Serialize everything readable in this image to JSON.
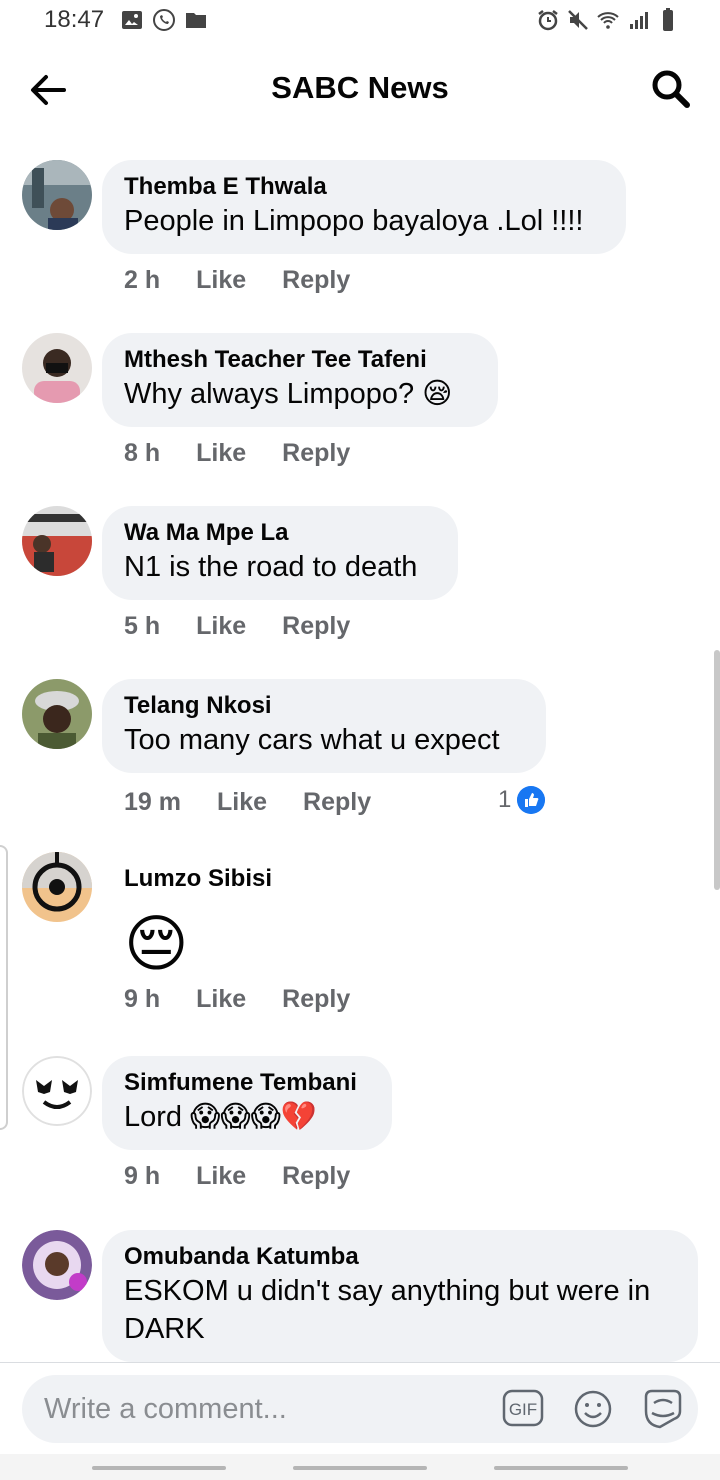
{
  "status_bar": {
    "time": "18:47",
    "left_icons": [
      "image-icon",
      "whatsapp-icon",
      "folder-icon"
    ],
    "right_icons": [
      "alarm-icon",
      "mute-icon",
      "wifi-icon",
      "signal-icon",
      "battery-icon"
    ]
  },
  "header": {
    "title": "SABC News",
    "back_icon": "arrow-left-icon",
    "search_icon": "search-icon"
  },
  "comments": [
    {
      "author": "Themba E Thwala",
      "text": "People in Limpopo bayaloya .Lol !!!!",
      "time": "2 h",
      "like_label": "Like",
      "reply_label": "Reply",
      "avatar_color": "#6b7f88"
    },
    {
      "author": "Mthesh Teacher Tee Tafeni",
      "text": "Why always Limpopo? 😪",
      "time": "8 h",
      "like_label": "Like",
      "reply_label": "Reply",
      "avatar_color": "#d9a2b0"
    },
    {
      "author": "Wa Ma Mpe La",
      "text": "N1 is the road to death",
      "time": "5 h",
      "like_label": "Like",
      "reply_label": "Reply",
      "avatar_color": "#c8473a"
    },
    {
      "author": "Telang Nkosi",
      "text": "Too many cars what u expect",
      "time": "19 m",
      "like_label": "Like",
      "reply_label": "Reply",
      "reaction_count": "1",
      "avatar_color": "#6d7d52"
    },
    {
      "author": "Lumzo Sibisi",
      "text": "😔",
      "time": "9 h",
      "like_label": "Like",
      "reply_label": "Reply",
      "avatar_color": "#e8b07a"
    },
    {
      "author": "Simfumene Tembani",
      "text": "Lord 😱😱😱💔",
      "time": "9 h",
      "like_label": "Like",
      "reply_label": "Reply",
      "avatar_color": "#ffffff"
    },
    {
      "author": "Omubanda Katumba",
      "text": "ESKOM u didn't say anything but were in DARK",
      "avatar_color": "#7a5a9a"
    }
  ],
  "composer": {
    "placeholder": "Write a comment...",
    "gif_label": "GIF",
    "emoji_icon": "smiley-icon",
    "sticker_icon": "sticker-icon"
  },
  "colors": {
    "bubble": "#f0f2f5",
    "meta_text": "#65676b",
    "like_blue": "#1877f2"
  }
}
